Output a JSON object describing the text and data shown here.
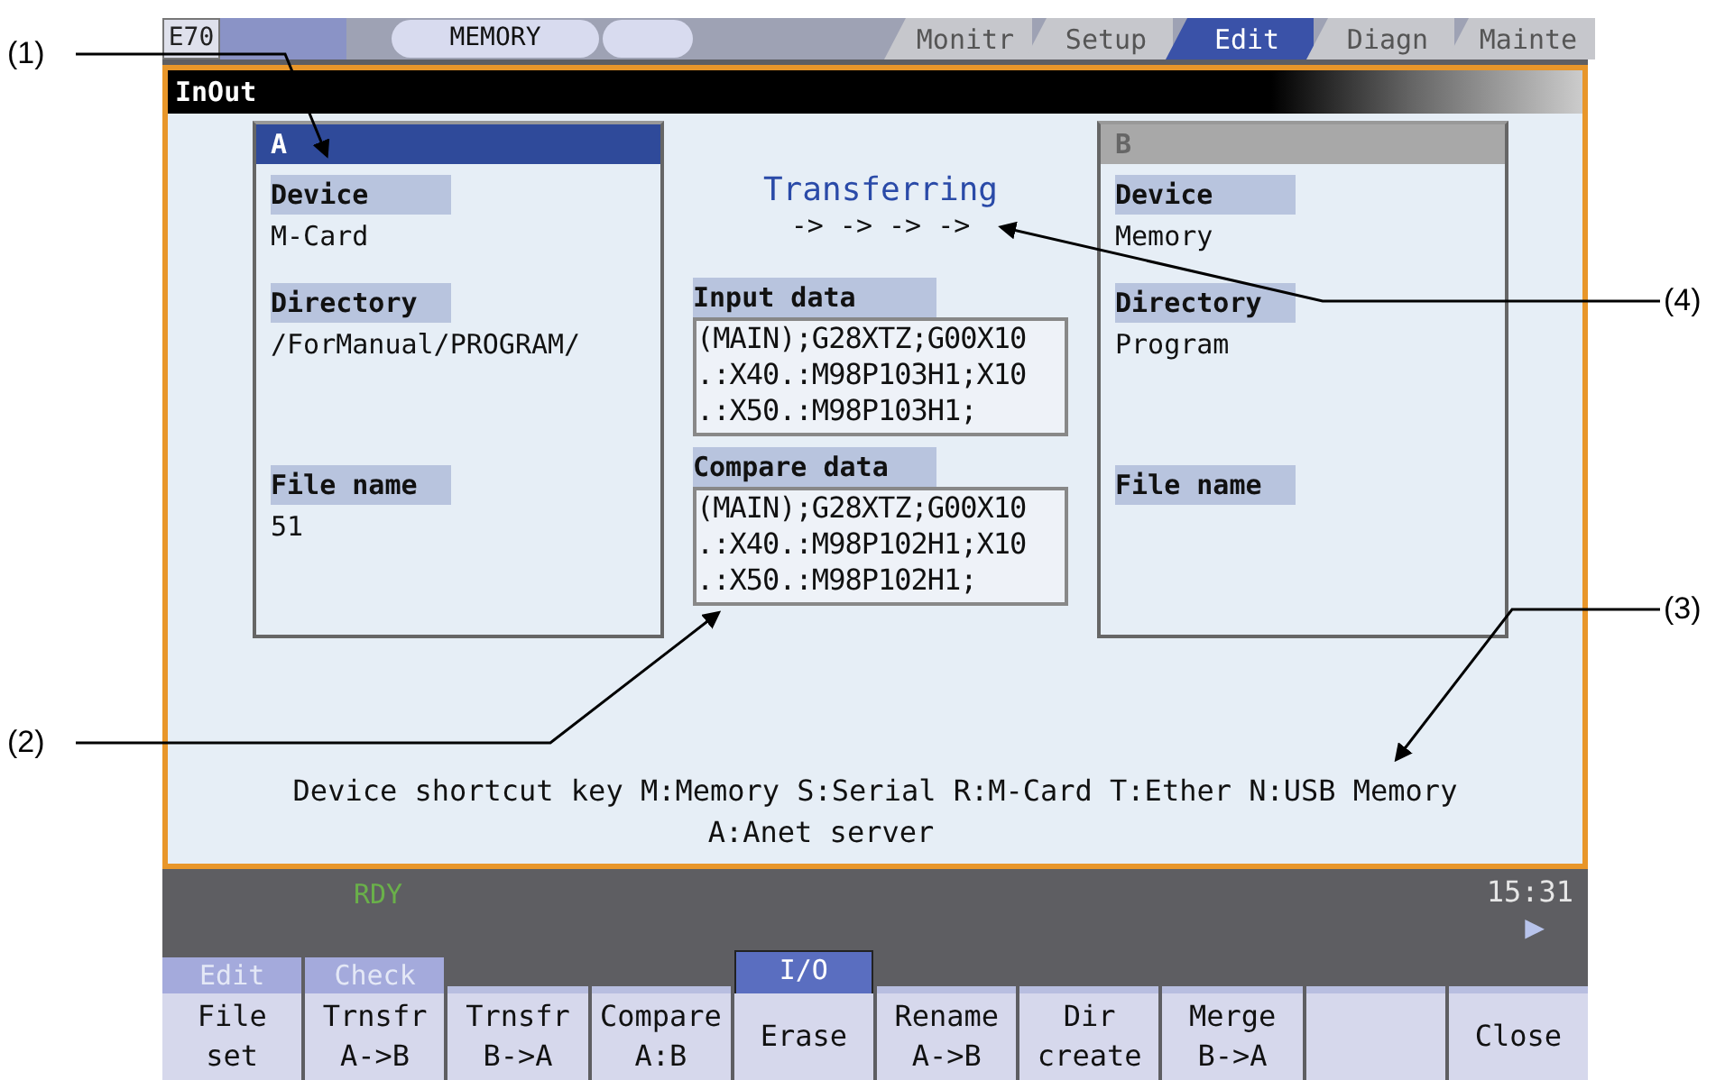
{
  "header": {
    "machine": "E70",
    "mode": "MEMORY",
    "tabs": [
      {
        "label": "Monitr",
        "selected": false
      },
      {
        "label": "Setup",
        "selected": false
      },
      {
        "label": "Edit",
        "selected": true
      },
      {
        "label": "Diagn",
        "selected": false
      },
      {
        "label": "Mainte",
        "selected": false
      }
    ]
  },
  "window": {
    "title": "InOut"
  },
  "panels": [
    {
      "title": "A",
      "active": true,
      "fields": [
        {
          "label": "Device",
          "value": "M-Card"
        },
        {
          "label": "Directory",
          "value": "/ForManual/PROGRAM/"
        },
        {
          "label": "File name",
          "value": "51"
        }
      ]
    },
    {
      "title": "B",
      "active": false,
      "fields": [
        {
          "label": "Device",
          "value": "Memory"
        },
        {
          "label": "Directory",
          "value": "Program"
        },
        {
          "label": "File name"
        }
      ]
    }
  ],
  "transfer": {
    "status": "Transferring",
    "progress": "-> -> -> ->"
  },
  "data_boxes": [
    {
      "label": "Input data",
      "lines": [
        "(MAIN);G28XTZ;G00X10",
        ".:X40.:M98P103H1;X10",
        ".:X50.:M98P103H1;"
      ]
    },
    {
      "label": "Compare data",
      "lines": [
        "(MAIN);G28XTZ;G00X10",
        ".:X40.:M98P102H1;X10",
        ".:X50.:M98P102H1;"
      ]
    }
  ],
  "shortcut_help": [
    "Device shortcut key M:Memory S:Serial R:M-Card T:Ether N:USB Memory",
    "A:Anet server"
  ],
  "status_bar": {
    "state": "RDY",
    "time": "15:31",
    "next": "▶"
  },
  "softkeys": [
    {
      "kind": "key",
      "lines": [
        "File",
        "set"
      ],
      "group": {
        "label": "Edit",
        "selected": false
      }
    },
    {
      "kind": "key",
      "lines": [
        "Trnsfr",
        "A->B"
      ],
      "group": {
        "label": "Check",
        "selected": false
      }
    },
    {
      "kind": "key",
      "lines": [
        "Trnsfr",
        "B->A"
      ]
    },
    {
      "kind": "key",
      "lines": [
        "Compare",
        "A:B"
      ]
    },
    {
      "kind": "key",
      "lines": [
        "Erase"
      ],
      "group": {
        "label": "I/O",
        "selected": true
      }
    },
    {
      "kind": "key",
      "lines": [
        "Rename",
        "A->B"
      ]
    },
    {
      "kind": "key",
      "lines": [
        "Dir",
        "create"
      ]
    },
    {
      "kind": "key",
      "lines": [
        "Merge",
        "B->A"
      ]
    },
    {
      "kind": "blank"
    },
    {
      "kind": "key",
      "lines": [
        "Close"
      ]
    }
  ],
  "callouts": [
    "(1)",
    "(2)",
    "(3)",
    "(4)"
  ]
}
